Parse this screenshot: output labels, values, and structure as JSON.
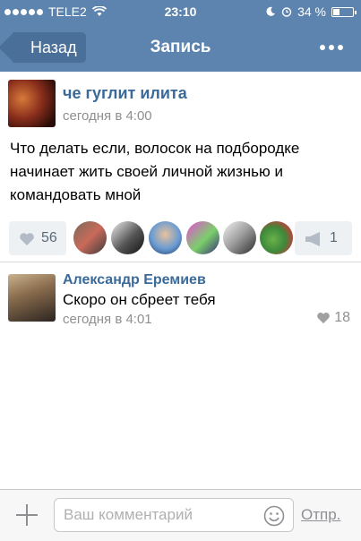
{
  "status_bar": {
    "carrier": "TELE2",
    "time": "23:10",
    "battery": "34 %"
  },
  "nav": {
    "back_label": "Назад",
    "title": "Запись"
  },
  "post": {
    "author": "че гуглит илита",
    "date": "сегодня в 4:00",
    "text": "Что делать если, волосок на подбородке начинает жить своей личной жизнью и командовать мной",
    "likes": "56",
    "reposts": "1"
  },
  "comment": {
    "author": "Александр Еремиев",
    "text": "Скоро он сбреет тебя",
    "date": "сегодня в 4:01",
    "likes": "18"
  },
  "composer": {
    "placeholder": "Ваш комментарий",
    "send_label": "Отпр."
  },
  "colors": {
    "header": "#5d84ae",
    "back_button": "#4a6f98",
    "link": "#3a6a99",
    "muted": "#8f8f8f"
  }
}
